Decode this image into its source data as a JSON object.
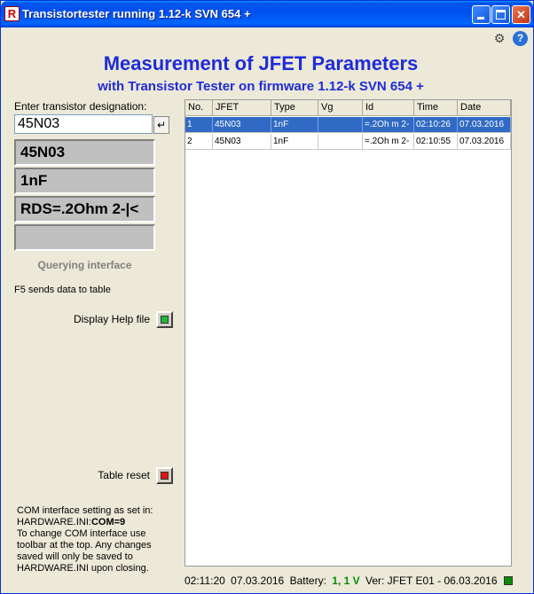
{
  "window": {
    "title": "Transistortester running 1.12-k SVN 654 +",
    "app_icon_glyph": "R",
    "minimize_glyph": "",
    "maximize_glyph": "",
    "close_glyph": "✕"
  },
  "toolbar": {
    "hardware_icon": "hardware-settings-icon",
    "hardware_glyph": "⚙",
    "help_icon": "help-icon",
    "help_glyph": "?"
  },
  "header": {
    "title": "Measurement of JFET Parameters",
    "subtitle": "with Transistor Tester on firmware 1.12-k SVN 654 +"
  },
  "left_panel": {
    "designation_label": "Enter transistor designation:",
    "designation_value": "45N03",
    "enter_glyph": "↵",
    "values": [
      "45N03",
      "1nF",
      "RDS=.2Ohm  2-|<",
      ""
    ],
    "querying_label": "Querying interface",
    "f5_hint": "F5 sends data to table",
    "help_label": "Display Help file",
    "reset_label": "Table reset",
    "com_info": {
      "line1": "COM interface setting as set in:",
      "line2_prefix": "HARDWARE.INI:",
      "line2_value": "COM=9",
      "line3": "To change COM interface use",
      "line4": "toolbar at the top. Any changes",
      "line5": "saved will only be saved to",
      "line6": "HARDWARE.INI upon closing."
    }
  },
  "table": {
    "columns": [
      "No.",
      "JFET",
      "Type",
      "Vg",
      "Id",
      "Time",
      "Date"
    ],
    "rows": [
      [
        "1",
        "45N03",
        "1nF",
        "",
        "=.2Oh m  2-",
        "02:10:26",
        "07.03.2016"
      ],
      [
        "2",
        "45N03",
        "1nF",
        "",
        "=.2Oh m  2-",
        "02:10:55",
        "07.03.2016"
      ]
    ]
  },
  "status": {
    "time": "02:11:20",
    "date": "07.03.2016",
    "battery_label": "Battery:",
    "battery_value": "1, 1  V",
    "version": "Ver: JFET E01 - 06.03.2016"
  },
  "colors": {
    "heading": "#1f2bd9",
    "selected_row": "#316ac5",
    "battery": "#0a8a0a",
    "help_button": "#1dba3a",
    "reset_button": "#e01515"
  }
}
